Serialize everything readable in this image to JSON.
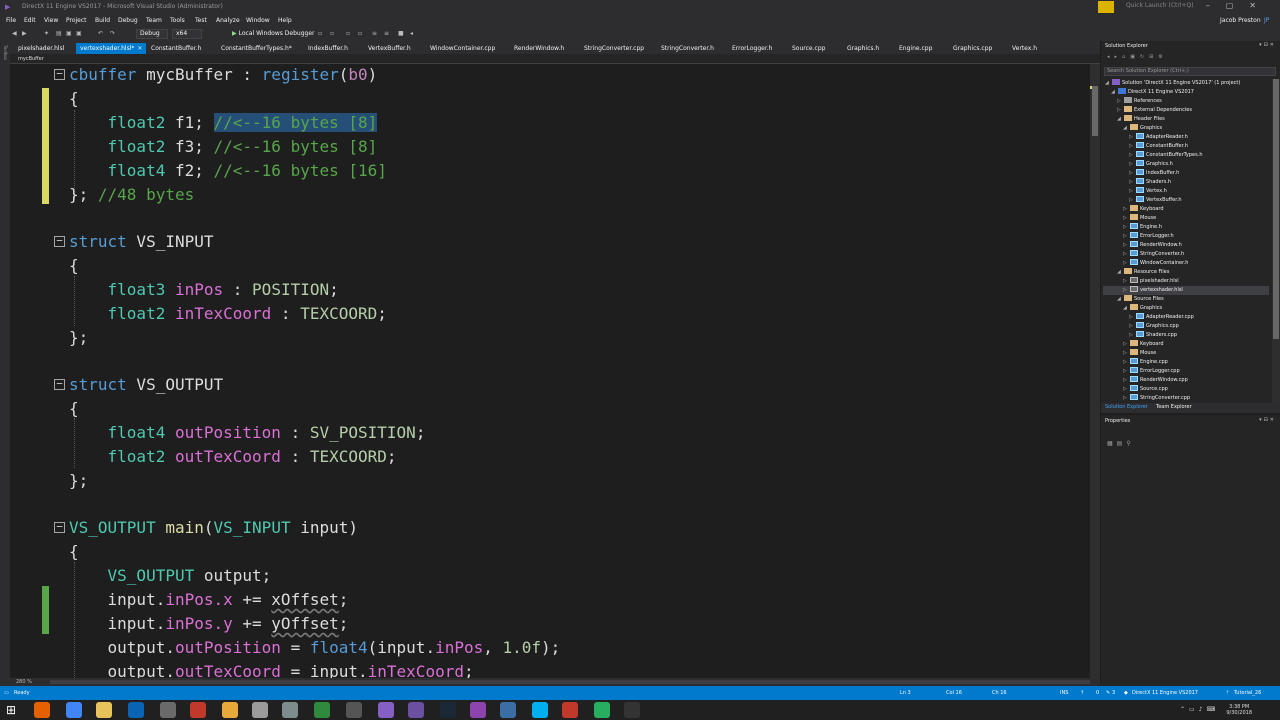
{
  "window": {
    "title": "DirectX 11 Engine VS2017 - Microsoft Visual Studio (Administrator)",
    "quick_launch_placeholder": "Quick Launch (Ctrl+Q)",
    "user": "Jacob Preston",
    "user_initials": "JP"
  },
  "menu": [
    "File",
    "Edit",
    "View",
    "Project",
    "Build",
    "Debug",
    "Team",
    "Tools",
    "Test",
    "Analyze",
    "Window",
    "Help"
  ],
  "toolbar": {
    "config": "Debug",
    "platform": "x64",
    "debugger": "Local Windows Debugger"
  },
  "tabs": [
    {
      "label": "pixelshader.hlsl",
      "active": false
    },
    {
      "label": "vertexshader.hlsl*",
      "active": true
    },
    {
      "label": "ConstantBuffer.h",
      "active": false
    },
    {
      "label": "ConstantBufferTypes.h*",
      "active": false
    },
    {
      "label": "IndexBuffer.h",
      "active": false
    },
    {
      "label": "VertexBuffer.h",
      "active": false
    },
    {
      "label": "WindowContainer.cpp",
      "active": false
    },
    {
      "label": "RenderWindow.h",
      "active": false
    },
    {
      "label": "StringConverter.cpp",
      "active": false
    },
    {
      "label": "StringConverter.h",
      "active": false
    },
    {
      "label": "ErrorLogger.h",
      "active": false
    },
    {
      "label": "Source.cpp",
      "active": false
    },
    {
      "label": "Graphics.h",
      "active": false
    },
    {
      "label": "Engine.cpp",
      "active": false
    },
    {
      "label": "Graphics.cpp",
      "active": false
    },
    {
      "label": "Vertex.h",
      "active": false
    }
  ],
  "toolbox_label": "Toolbox",
  "navbar": {
    "scope": "mycBuffer"
  },
  "code": {
    "l1": {
      "kw": "cbuffer",
      "name": " mycBuffer : ",
      "fn": "register",
      "open": "(",
      "arg": "b0",
      "close": ")"
    },
    "l2": "{",
    "l3": {
      "ty": "float2",
      "id": " f1; ",
      "cmt": "//<--16 bytes [8]"
    },
    "l4": {
      "ty": "float2",
      "id": " f3; ",
      "cmt": "//<--16 bytes [8]"
    },
    "l5": {
      "ty": "float4",
      "id": " f2; ",
      "cmt": "//<--16 bytes [16]"
    },
    "l6": {
      "txt": "}; ",
      "cmt": "//48 bytes"
    },
    "l7": {
      "kw": "struct",
      "name": " VS_INPUT"
    },
    "l8": "{",
    "l9": {
      "ty": "float3",
      "mem": "inPos",
      "sep": " : ",
      "sem": "POSITION",
      "end": ";"
    },
    "l10": {
      "ty": "float2",
      "mem": "inTexCoord",
      "sep": " : ",
      "sem": "TEXCOORD",
      "end": ";"
    },
    "l11": "};",
    "l12": {
      "kw": "struct",
      "name": " VS_OUTPUT"
    },
    "l13": "{",
    "l14": {
      "ty": "float4",
      "mem": "outPosition",
      "sep": " : ",
      "sem": "SV_POSITION",
      "end": ";"
    },
    "l15": {
      "ty": "float2",
      "mem": "outTexCoord",
      "sep": " : ",
      "sem": "TEXCOORD",
      "end": ";"
    },
    "l16": "};",
    "l17": {
      "ret": "VS_OUTPUT",
      "fn": "main",
      "open": "(",
      "ptype": "VS_INPUT",
      "pname": " input",
      "close": ")"
    },
    "l18": "{",
    "l19": {
      "ty": "VS_OUTPUT",
      "rest": " output;"
    },
    "l20": {
      "a": "input.",
      "m": "inPos.x",
      "op": " += ",
      "v": "xOffset",
      "end": ";"
    },
    "l21": {
      "a": "input.",
      "m": "inPos.y",
      "op": " += ",
      "v": "yOffset",
      "end": ";"
    },
    "l22": {
      "a": "output.",
      "m": "outPosition",
      "op": " = ",
      "fn": "float4",
      "open": "(input.",
      "m2": "inPos",
      "args": ", ",
      "num": "1.0f",
      "close": ");"
    },
    "l23": {
      "a": "output.",
      "m": "outTexCoord",
      "op": " = ",
      "b": "input.",
      "m2": "inTexCoord",
      "end": ";"
    }
  },
  "zoom": "280 %",
  "solution_explorer": {
    "title": "Solution Explorer",
    "search_placeholder": "Search Solution Explorer (Ctrl+;)",
    "items": [
      {
        "label": "Solution 'DirectX 11 Engine VS2017' (1 project)",
        "icon": "solution-icon"
      },
      {
        "label": "DirectX 11 Engine VS2017",
        "icon": "project-icon"
      },
      {
        "label": "References",
        "icon": "references-icon"
      },
      {
        "label": "External Dependencies",
        "icon": "folder-icon"
      },
      {
        "label": "Header Files",
        "icon": "folder-icon"
      },
      {
        "label": "Graphics",
        "icon": "folder-icon"
      },
      {
        "label": "AdapterReader.h",
        "icon": "header-file-icon"
      },
      {
        "label": "ConstantBuffer.h",
        "icon": "header-file-icon"
      },
      {
        "label": "ConstantBufferTypes.h",
        "icon": "header-file-icon"
      },
      {
        "label": "Graphics.h",
        "icon": "header-file-icon"
      },
      {
        "label": "IndexBuffer.h",
        "icon": "header-file-icon"
      },
      {
        "label": "Shaders.h",
        "icon": "header-file-icon"
      },
      {
        "label": "Vertex.h",
        "icon": "header-file-icon"
      },
      {
        "label": "VertexBuffer.h",
        "icon": "header-file-icon"
      },
      {
        "label": "Keyboard",
        "icon": "folder-icon"
      },
      {
        "label": "Mouse",
        "icon": "folder-icon"
      },
      {
        "label": "Engine.h",
        "icon": "header-file-icon"
      },
      {
        "label": "ErrorLogger.h",
        "icon": "header-file-icon"
      },
      {
        "label": "RenderWindow.h",
        "icon": "header-file-icon"
      },
      {
        "label": "StringConverter.h",
        "icon": "header-file-icon"
      },
      {
        "label": "WindowContainer.h",
        "icon": "header-file-icon"
      },
      {
        "label": "Resource Files",
        "icon": "folder-icon"
      },
      {
        "label": "pixelshader.hlsl",
        "icon": "hlsl-file-icon"
      },
      {
        "label": "vertexshader.hlsl",
        "icon": "hlsl-file-icon"
      },
      {
        "label": "Source Files",
        "icon": "folder-icon"
      },
      {
        "label": "Graphics",
        "icon": "folder-icon"
      },
      {
        "label": "AdapterReader.cpp",
        "icon": "cpp-file-icon"
      },
      {
        "label": "Graphics.cpp",
        "icon": "cpp-file-icon"
      },
      {
        "label": "Shaders.cpp",
        "icon": "cpp-file-icon"
      },
      {
        "label": "Keyboard",
        "icon": "folder-icon"
      },
      {
        "label": "Mouse",
        "icon": "folder-icon"
      },
      {
        "label": "Engine.cpp",
        "icon": "cpp-file-icon"
      },
      {
        "label": "ErrorLogger.cpp",
        "icon": "cpp-file-icon"
      },
      {
        "label": "RenderWindow.cpp",
        "icon": "cpp-file-icon"
      },
      {
        "label": "Source.cpp",
        "icon": "cpp-file-icon"
      },
      {
        "label": "StringConverter.cpp",
        "icon": "cpp-file-icon"
      }
    ],
    "tab_solution": "Solution Explorer",
    "tab_team": "Team Explorer"
  },
  "properties": {
    "title": "Properties"
  },
  "status": {
    "ready": "Ready",
    "ln": "Ln 3",
    "col": "Col 16",
    "ch": "Ch 16",
    "ins": "INS",
    "up_count": "0",
    "edit_count": "3",
    "project": "DirectX 11 Engine VS2017",
    "branch": "Tutorial_26"
  },
  "clock": {
    "time": "3:38 PM",
    "date": "9/30/2018"
  },
  "colors": {
    "accent": "#007acc",
    "editor_bg": "#1e1e1e",
    "keyword": "#569cd6",
    "type": "#4ec9b0",
    "comment": "#57a64a",
    "member": "#da70d6",
    "semantic": "#b5cea8",
    "selection": "#264f78"
  }
}
